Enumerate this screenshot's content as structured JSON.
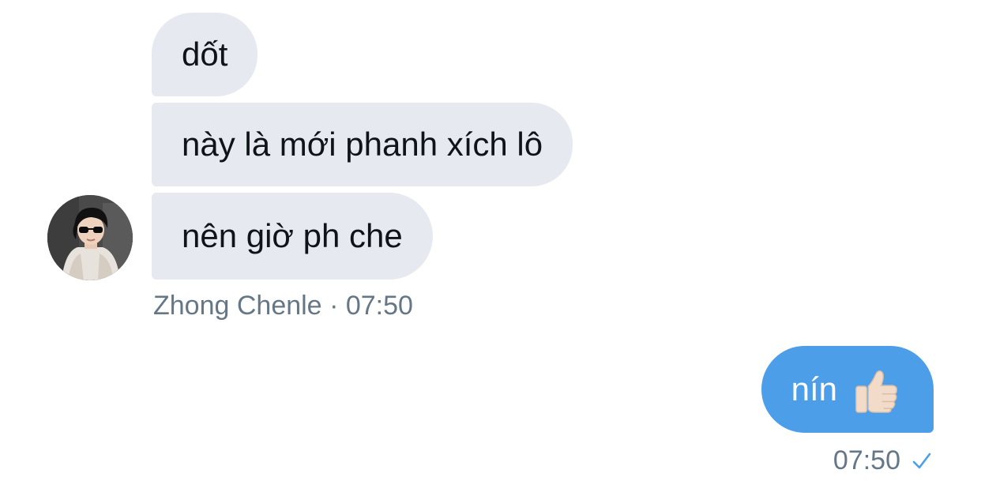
{
  "conversation": {
    "incoming": {
      "messages": [
        {
          "text": "dốt"
        },
        {
          "text": "này là mới phanh xích lô"
        },
        {
          "text": "nên giờ ph che"
        }
      ],
      "sender_name": "Zhong Chenle",
      "separator": "·",
      "time": "07:50",
      "avatar_icon": "user-avatar-photo"
    },
    "outgoing": {
      "text": "nín",
      "emoji_icon": "thumbs-up-emoji",
      "time": "07:50",
      "status_icon": "checkmark-icon",
      "bubble_color": "#4c9ee9"
    },
    "colors": {
      "incoming_bubble": "#e6e9ef",
      "meta_text": "#657786"
    }
  }
}
